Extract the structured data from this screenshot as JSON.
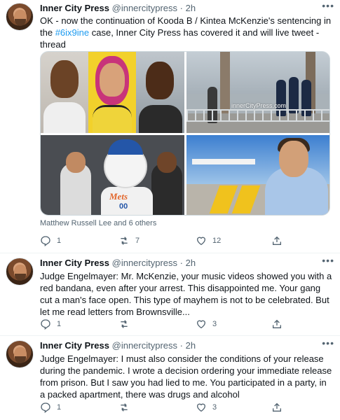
{
  "tweets": [
    {
      "name": "Inner City Press",
      "handle": "@innercitypress",
      "dot": "·",
      "time": "2h",
      "more": "•••",
      "text_before": "OK - now the continuation of Kooda B / Kintea McKenzie's sentencing in the ",
      "hashtag": "#6ix9ine",
      "text_after": " case, Inner City Press has covered it and will live tweet - thread",
      "media_watermark": "innerCityPress.com",
      "media_jersey_text": "Mets",
      "media_jersey_number": "00",
      "credit": "Matthew Russell Lee and 6 others",
      "replies": "1",
      "retweets": "7",
      "likes": "12"
    },
    {
      "name": "Inner City Press",
      "handle": "@innercitypress",
      "dot": "·",
      "time": "2h",
      "more": "•••",
      "text": "Judge Engelmayer: Mr. McKenzie, your music videos showed you with a red bandana, even after your arrest. This disappointed me. Your gang cut a man's face open. This type of mayhem is not to be celebrated. But let me read letters from Brownsville...",
      "replies": "1",
      "retweets": "",
      "likes": "3"
    },
    {
      "name": "Inner City Press",
      "handle": "@innercitypress",
      "dot": "·",
      "time": "2h",
      "more": "•••",
      "text": "Judge Engelmayer: I must also consider the conditions of your release during the pandemic. I wrote a decision ordering your immediate release from prison. But I saw you had lied to me. You participated in a party, in a packed apartment, there was drugs and alcohol",
      "replies": "1",
      "retweets": "",
      "likes": "3"
    }
  ],
  "colors": {
    "link": "#1d9bf0",
    "muted": "#536471",
    "text": "#0f1419"
  },
  "icons": [
    "reply-icon",
    "retweet-icon",
    "like-icon",
    "share-icon",
    "more-icon"
  ]
}
